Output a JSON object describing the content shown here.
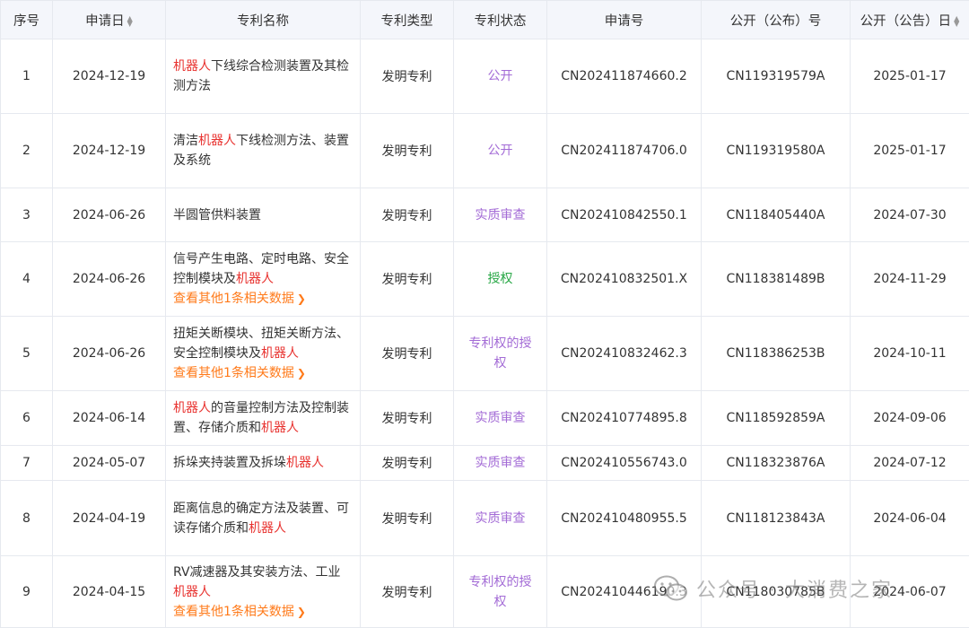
{
  "headers": {
    "index": "序号",
    "apply_date": "申请日",
    "name": "专利名称",
    "type": "专利类型",
    "status": "专利状态",
    "apply_no": "申请号",
    "pub_no": "公开（公布）号",
    "pub_date": "公开（公告）日"
  },
  "rows": [
    {
      "index": "1",
      "apply_date": "2024-12-19",
      "name_pre": "",
      "name_hl": "机器人",
      "name_post": "下线综合检测装置及其检测方法",
      "name_hl2": "",
      "name_post2": "",
      "more": "",
      "type": "发明专利",
      "status": "公开",
      "apply_no": "CN202411874660.2",
      "pub_no": "CN119319579A",
      "pub_date": "2025-01-17"
    },
    {
      "index": "2",
      "apply_date": "2024-12-19",
      "name_pre": "清洁",
      "name_hl": "机器人",
      "name_post": "下线检测方法、装置及系统",
      "name_hl2": "",
      "name_post2": "",
      "more": "",
      "type": "发明专利",
      "status": "公开",
      "apply_no": "CN202411874706.0",
      "pub_no": "CN119319580A",
      "pub_date": "2025-01-17"
    },
    {
      "index": "3",
      "apply_date": "2024-06-26",
      "name_pre": "半圆管供料装置",
      "name_hl": "",
      "name_post": "",
      "name_hl2": "",
      "name_post2": "",
      "more": "",
      "type": "发明专利",
      "status": "实质审查",
      "apply_no": "CN202410842550.1",
      "pub_no": "CN118405440A",
      "pub_date": "2024-07-30"
    },
    {
      "index": "4",
      "apply_date": "2024-06-26",
      "name_pre": "信号产生电路、定时电路、安全控制模块及",
      "name_hl": "机器人",
      "name_post": "",
      "name_hl2": "",
      "name_post2": "",
      "more": "查看其他1条相关数据",
      "type": "发明专利",
      "status": "授权",
      "apply_no": "CN202410832501.X",
      "pub_no": "CN118381489B",
      "pub_date": "2024-11-29"
    },
    {
      "index": "5",
      "apply_date": "2024-06-26",
      "name_pre": "扭矩关断模块、扭矩关断方法、安全控制模块及",
      "name_hl": "机器人",
      "name_post": "",
      "name_hl2": "",
      "name_post2": "",
      "more": "查看其他1条相关数据",
      "type": "发明专利",
      "status": "专利权的授权",
      "apply_no": "CN202410832462.3",
      "pub_no": "CN118386253B",
      "pub_date": "2024-10-11"
    },
    {
      "index": "6",
      "apply_date": "2024-06-14",
      "name_pre": "",
      "name_hl": "机器人",
      "name_post": "的音量控制方法及控制装置、存储介质和",
      "name_hl2": "机器人",
      "name_post2": "",
      "more": "",
      "type": "发明专利",
      "status": "实质审查",
      "apply_no": "CN202410774895.8",
      "pub_no": "CN118592859A",
      "pub_date": "2024-09-06"
    },
    {
      "index": "7",
      "apply_date": "2024-05-07",
      "name_pre": "拆垛夹持装置及拆垛",
      "name_hl": "机器人",
      "name_post": "",
      "name_hl2": "",
      "name_post2": "",
      "more": "",
      "type": "发明专利",
      "status": "实质审查",
      "apply_no": "CN202410556743.0",
      "pub_no": "CN118323876A",
      "pub_date": "2024-07-12"
    },
    {
      "index": "8",
      "apply_date": "2024-04-19",
      "name_pre": "距离信息的确定方法及装置、可读存储介质和",
      "name_hl": "机器人",
      "name_post": "",
      "name_hl2": "",
      "name_post2": "",
      "more": "",
      "type": "发明专利",
      "status": "实质审查",
      "apply_no": "CN202410480955.5",
      "pub_no": "CN118123843A",
      "pub_date": "2024-06-04"
    },
    {
      "index": "9",
      "apply_date": "2024-04-15",
      "name_pre": "RV减速器及其安装方法、工业",
      "name_hl": "机器人",
      "name_post": "",
      "name_hl2": "",
      "name_post2": "",
      "more": "查看其他1条相关数据",
      "type": "发明专利",
      "status": "专利权的授权",
      "apply_no": "CN202410446190.3",
      "pub_no": "CN118030785B",
      "pub_date": "2024-06-07"
    }
  ],
  "colors": {
    "highlight": "#e8322f",
    "more_link": "#ff7a1a",
    "status_purple": "#a36bd6",
    "status_green": "#27a745"
  },
  "watermark": {
    "text": "公众号 · 大消费之家",
    "icon": "wechat-icon"
  }
}
